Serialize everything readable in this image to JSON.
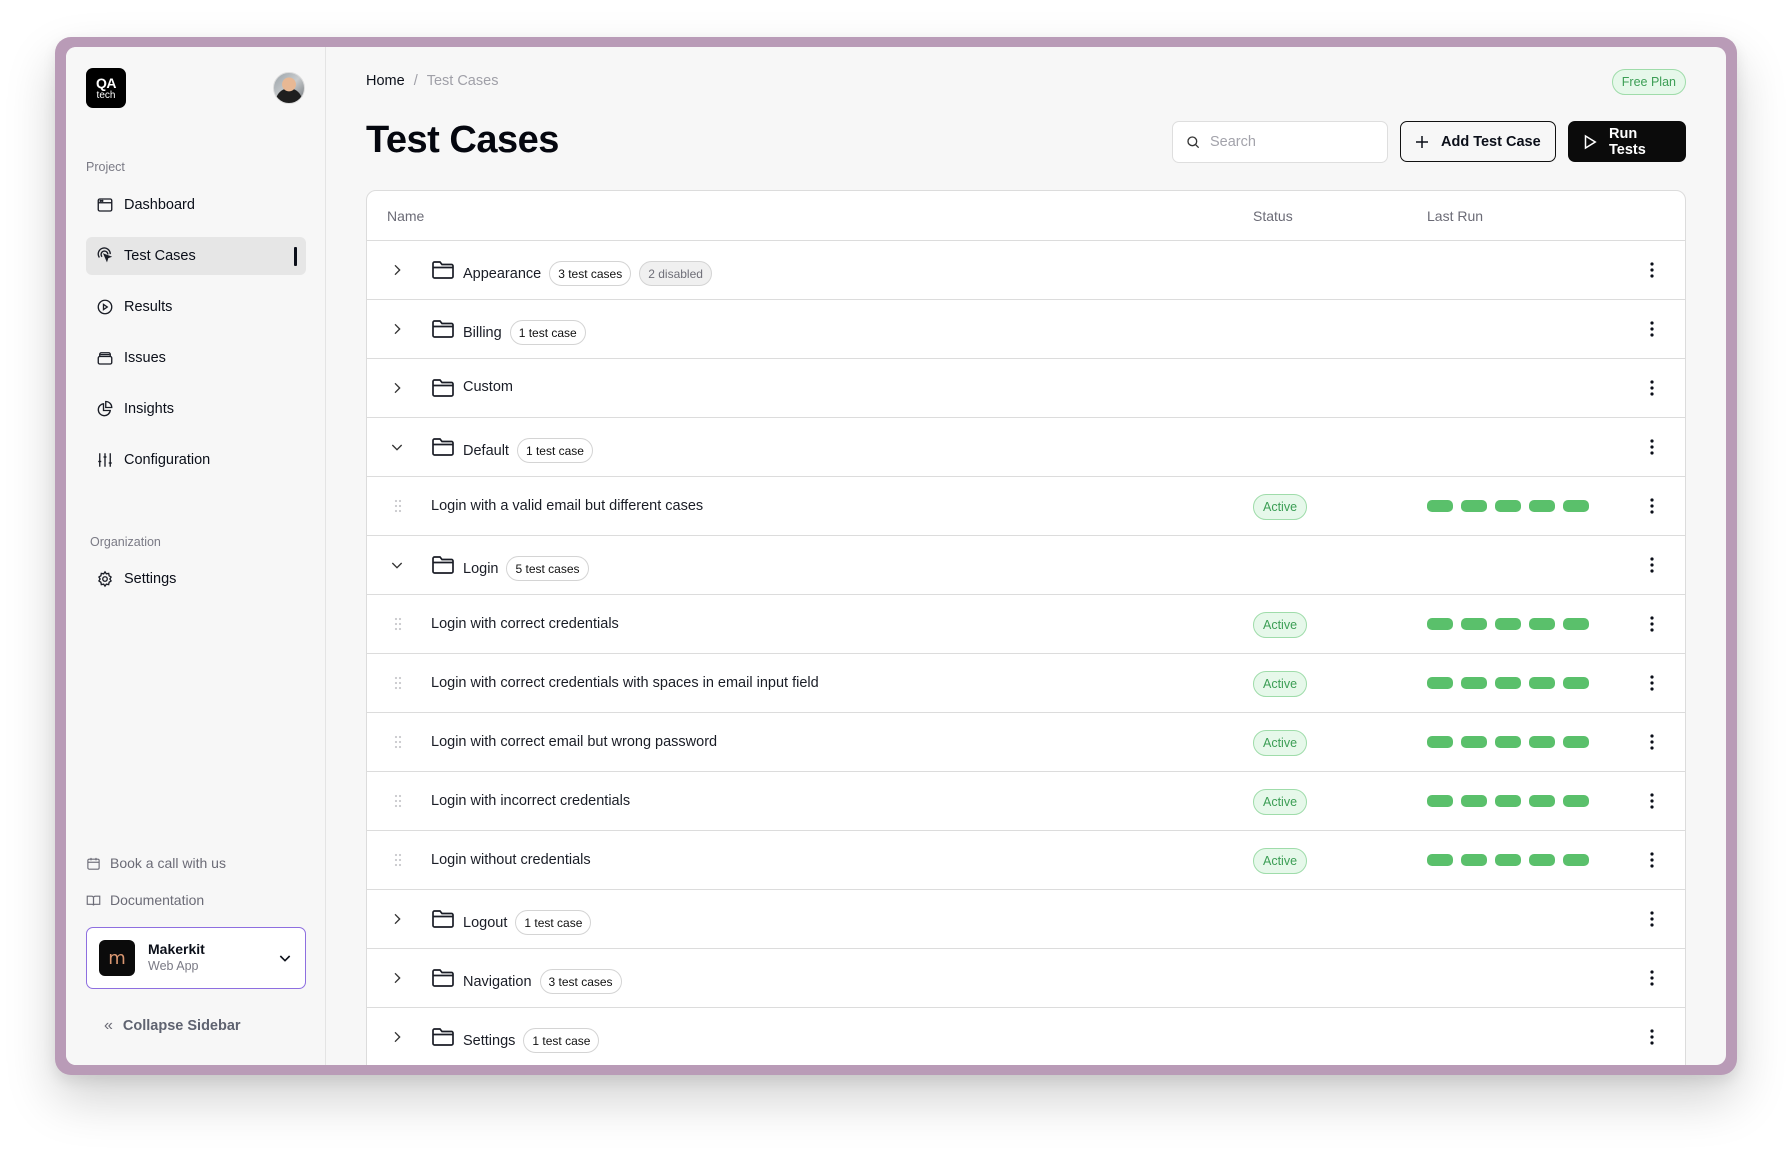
{
  "app": {
    "logo_line1": "QA",
    "logo_line2": "tech"
  },
  "sidebar": {
    "project_label": "Project",
    "items": [
      {
        "label": "Dashboard",
        "icon": "browser-window-icon",
        "active": false
      },
      {
        "label": "Test Cases",
        "icon": "pointer-target-icon",
        "active": true
      },
      {
        "label": "Results",
        "icon": "play-circle-icon",
        "active": false
      },
      {
        "label": "Issues",
        "icon": "archive-box-icon",
        "active": false
      },
      {
        "label": "Insights",
        "icon": "pie-chart-icon",
        "active": false
      },
      {
        "label": "Configuration",
        "icon": "sliders-icon",
        "active": false
      }
    ],
    "organization_label": "Organization",
    "org_items": [
      {
        "label": "Settings",
        "icon": "gear-icon"
      }
    ],
    "footer_links": [
      {
        "label": "Book a call with us",
        "icon": "calendar-icon"
      },
      {
        "label": "Documentation",
        "icon": "book-icon"
      }
    ],
    "account": {
      "logo_letter": "m",
      "name": "Makerkit",
      "subtitle": "Web App"
    },
    "collapse_label": "Collapse Sidebar"
  },
  "header": {
    "breadcrumb": {
      "home": "Home",
      "separator": "/",
      "current": "Test Cases"
    },
    "plan_badge": "Free Plan",
    "title": "Test Cases",
    "search_placeholder": "Search",
    "search_value": "",
    "add_button": "Add Test Case",
    "run_button": "Run Tests"
  },
  "colors": {
    "accent_green": "#5ac06b",
    "active_badge_bg": "#e6f8ea",
    "account_border": "#8e6fe0",
    "frame": "#b99bb7"
  },
  "table": {
    "columns": [
      "Name",
      "Status",
      "Last Run"
    ],
    "rows": [
      {
        "type": "folder",
        "name": "Appearance",
        "expanded": false,
        "badges": [
          "3 test cases",
          "2 disabled"
        ]
      },
      {
        "type": "folder",
        "name": "Billing",
        "expanded": false,
        "badges": [
          "1 test case"
        ]
      },
      {
        "type": "folder",
        "name": "Custom",
        "expanded": false,
        "badges": []
      },
      {
        "type": "folder",
        "name": "Default",
        "expanded": true,
        "badges": [
          "1 test case"
        ]
      },
      {
        "type": "test",
        "name": "Login with a valid email but different cases",
        "status": "Active",
        "last_runs": [
          "pass",
          "pass",
          "pass",
          "pass",
          "pass"
        ]
      },
      {
        "type": "folder",
        "name": "Login",
        "expanded": true,
        "badges": [
          "5 test cases"
        ]
      },
      {
        "type": "test",
        "name": "Login with correct credentials",
        "status": "Active",
        "last_runs": [
          "pass",
          "pass",
          "pass",
          "pass",
          "pass"
        ]
      },
      {
        "type": "test",
        "name": "Login with correct credentials with spaces in email input field",
        "status": "Active",
        "last_runs": [
          "pass",
          "pass",
          "pass",
          "pass",
          "pass"
        ]
      },
      {
        "type": "test",
        "name": "Login with correct email but wrong password",
        "status": "Active",
        "last_runs": [
          "pass",
          "pass",
          "pass",
          "pass",
          "pass"
        ]
      },
      {
        "type": "test",
        "name": "Login with incorrect credentials",
        "status": "Active",
        "last_runs": [
          "pass",
          "pass",
          "pass",
          "pass",
          "pass"
        ]
      },
      {
        "type": "test",
        "name": "Login without credentials",
        "status": "Active",
        "last_runs": [
          "pass",
          "pass",
          "pass",
          "pass",
          "pass"
        ]
      },
      {
        "type": "folder",
        "name": "Logout",
        "expanded": false,
        "badges": [
          "1 test case"
        ]
      },
      {
        "type": "folder",
        "name": "Navigation",
        "expanded": false,
        "badges": [
          "3 test cases"
        ]
      },
      {
        "type": "folder",
        "name": "Settings",
        "expanded": false,
        "badges": [
          "1 test case"
        ]
      }
    ]
  }
}
